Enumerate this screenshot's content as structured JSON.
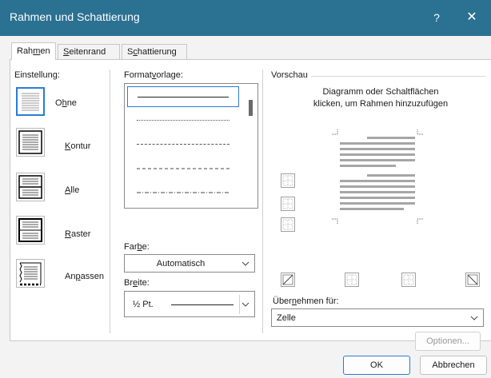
{
  "window": {
    "title": "Rahmen und Schattierung",
    "help_label": "?",
    "close_label": "✕"
  },
  "tabs": [
    {
      "pre": "Rah",
      "acc": "m",
      "post": "en"
    },
    {
      "pre": "",
      "acc": "S",
      "post": "eitenrand"
    },
    {
      "pre": "S",
      "acc": "c",
      "post": "hattierung"
    }
  ],
  "settings": {
    "label": "Einstellung:",
    "items": [
      {
        "pre": "O",
        "acc": "h",
        "post": "ne"
      },
      {
        "pre": "",
        "acc": "K",
        "post": "ontur"
      },
      {
        "pre": "",
        "acc": "A",
        "post": "lle"
      },
      {
        "pre": "",
        "acc": "R",
        "post": "aster"
      },
      {
        "pre": "An",
        "acc": "p",
        "post": "assen"
      }
    ]
  },
  "style": {
    "label_pre": "Format",
    "label_acc": "v",
    "label_post": "orlage:",
    "color_label_pre": "Far",
    "color_label_acc": "b",
    "color_label_post": "e:",
    "color_value": "Automatisch",
    "width_label_pre": "Br",
    "width_label_acc": "e",
    "width_label_post": "ite:",
    "width_value": "½ Pt."
  },
  "preview": {
    "label": "Vorschau",
    "hint_line1": "Diagramm oder Schaltflächen",
    "hint_line2": "klicken, um Rahmen hinzuzufügen"
  },
  "apply": {
    "label_pre": "Über",
    "label_acc": "n",
    "label_post": "ehmen für:",
    "value": "Zelle",
    "options_label": "Optionen..."
  },
  "footer": {
    "ok_label": "OK",
    "cancel_label": "Abbrechen"
  }
}
